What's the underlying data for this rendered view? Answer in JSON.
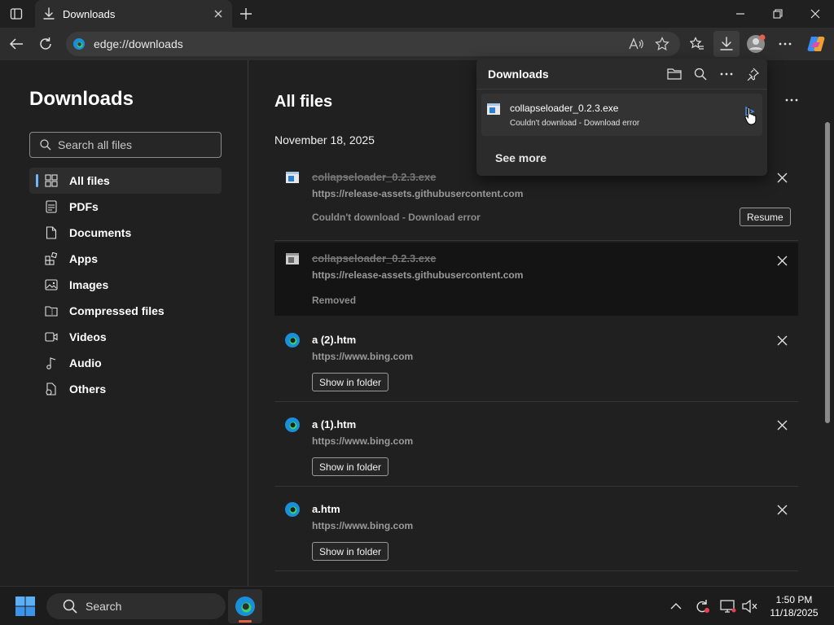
{
  "browser": {
    "tab_title": "Downloads",
    "address": "edge://downloads"
  },
  "sidebar": {
    "title": "Downloads",
    "search_placeholder": "Search all files",
    "items": [
      {
        "label": "All files",
        "icon": "grid-icon",
        "active": true
      },
      {
        "label": "PDFs",
        "icon": "pdf-icon"
      },
      {
        "label": "Documents",
        "icon": "document-icon"
      },
      {
        "label": "Apps",
        "icon": "apps-icon"
      },
      {
        "label": "Images",
        "icon": "image-icon"
      },
      {
        "label": "Compressed files",
        "icon": "compressed-file-icon"
      },
      {
        "label": "Videos",
        "icon": "video-icon"
      },
      {
        "label": "Audio",
        "icon": "audio-icon"
      },
      {
        "label": "Others",
        "icon": "other-files-icon"
      }
    ]
  },
  "main": {
    "title": "All files",
    "date": "November 18, 2025",
    "downloads": [
      {
        "name": "collapseloader_0.2.3.exe",
        "url": "https://release-assets.githubusercontent.com",
        "status": "Couldn't download - Download error",
        "action": "Resume",
        "struck": true
      },
      {
        "name": "collapseloader_0.2.3.exe",
        "url": "https://release-assets.githubusercontent.com",
        "status": "Removed",
        "struck": true
      },
      {
        "name": "a (2).htm",
        "url": "https://www.bing.com",
        "action": "Show in folder"
      },
      {
        "name": "a (1).htm",
        "url": "https://www.bing.com",
        "action": "Show in folder"
      },
      {
        "name": "a.htm",
        "url": "https://www.bing.com",
        "action": "Show in folder"
      }
    ]
  },
  "flyout": {
    "title": "Downloads",
    "item": {
      "name": "collapseloader_0.2.3.exe",
      "status": "Couldn't download - Download error"
    },
    "see_more": "See more"
  },
  "taskbar": {
    "search_label": "Search",
    "time": "1:50 PM",
    "date": "11/18/2025"
  },
  "colors": {
    "accent": "#6fb6ff",
    "background": "#202020"
  }
}
